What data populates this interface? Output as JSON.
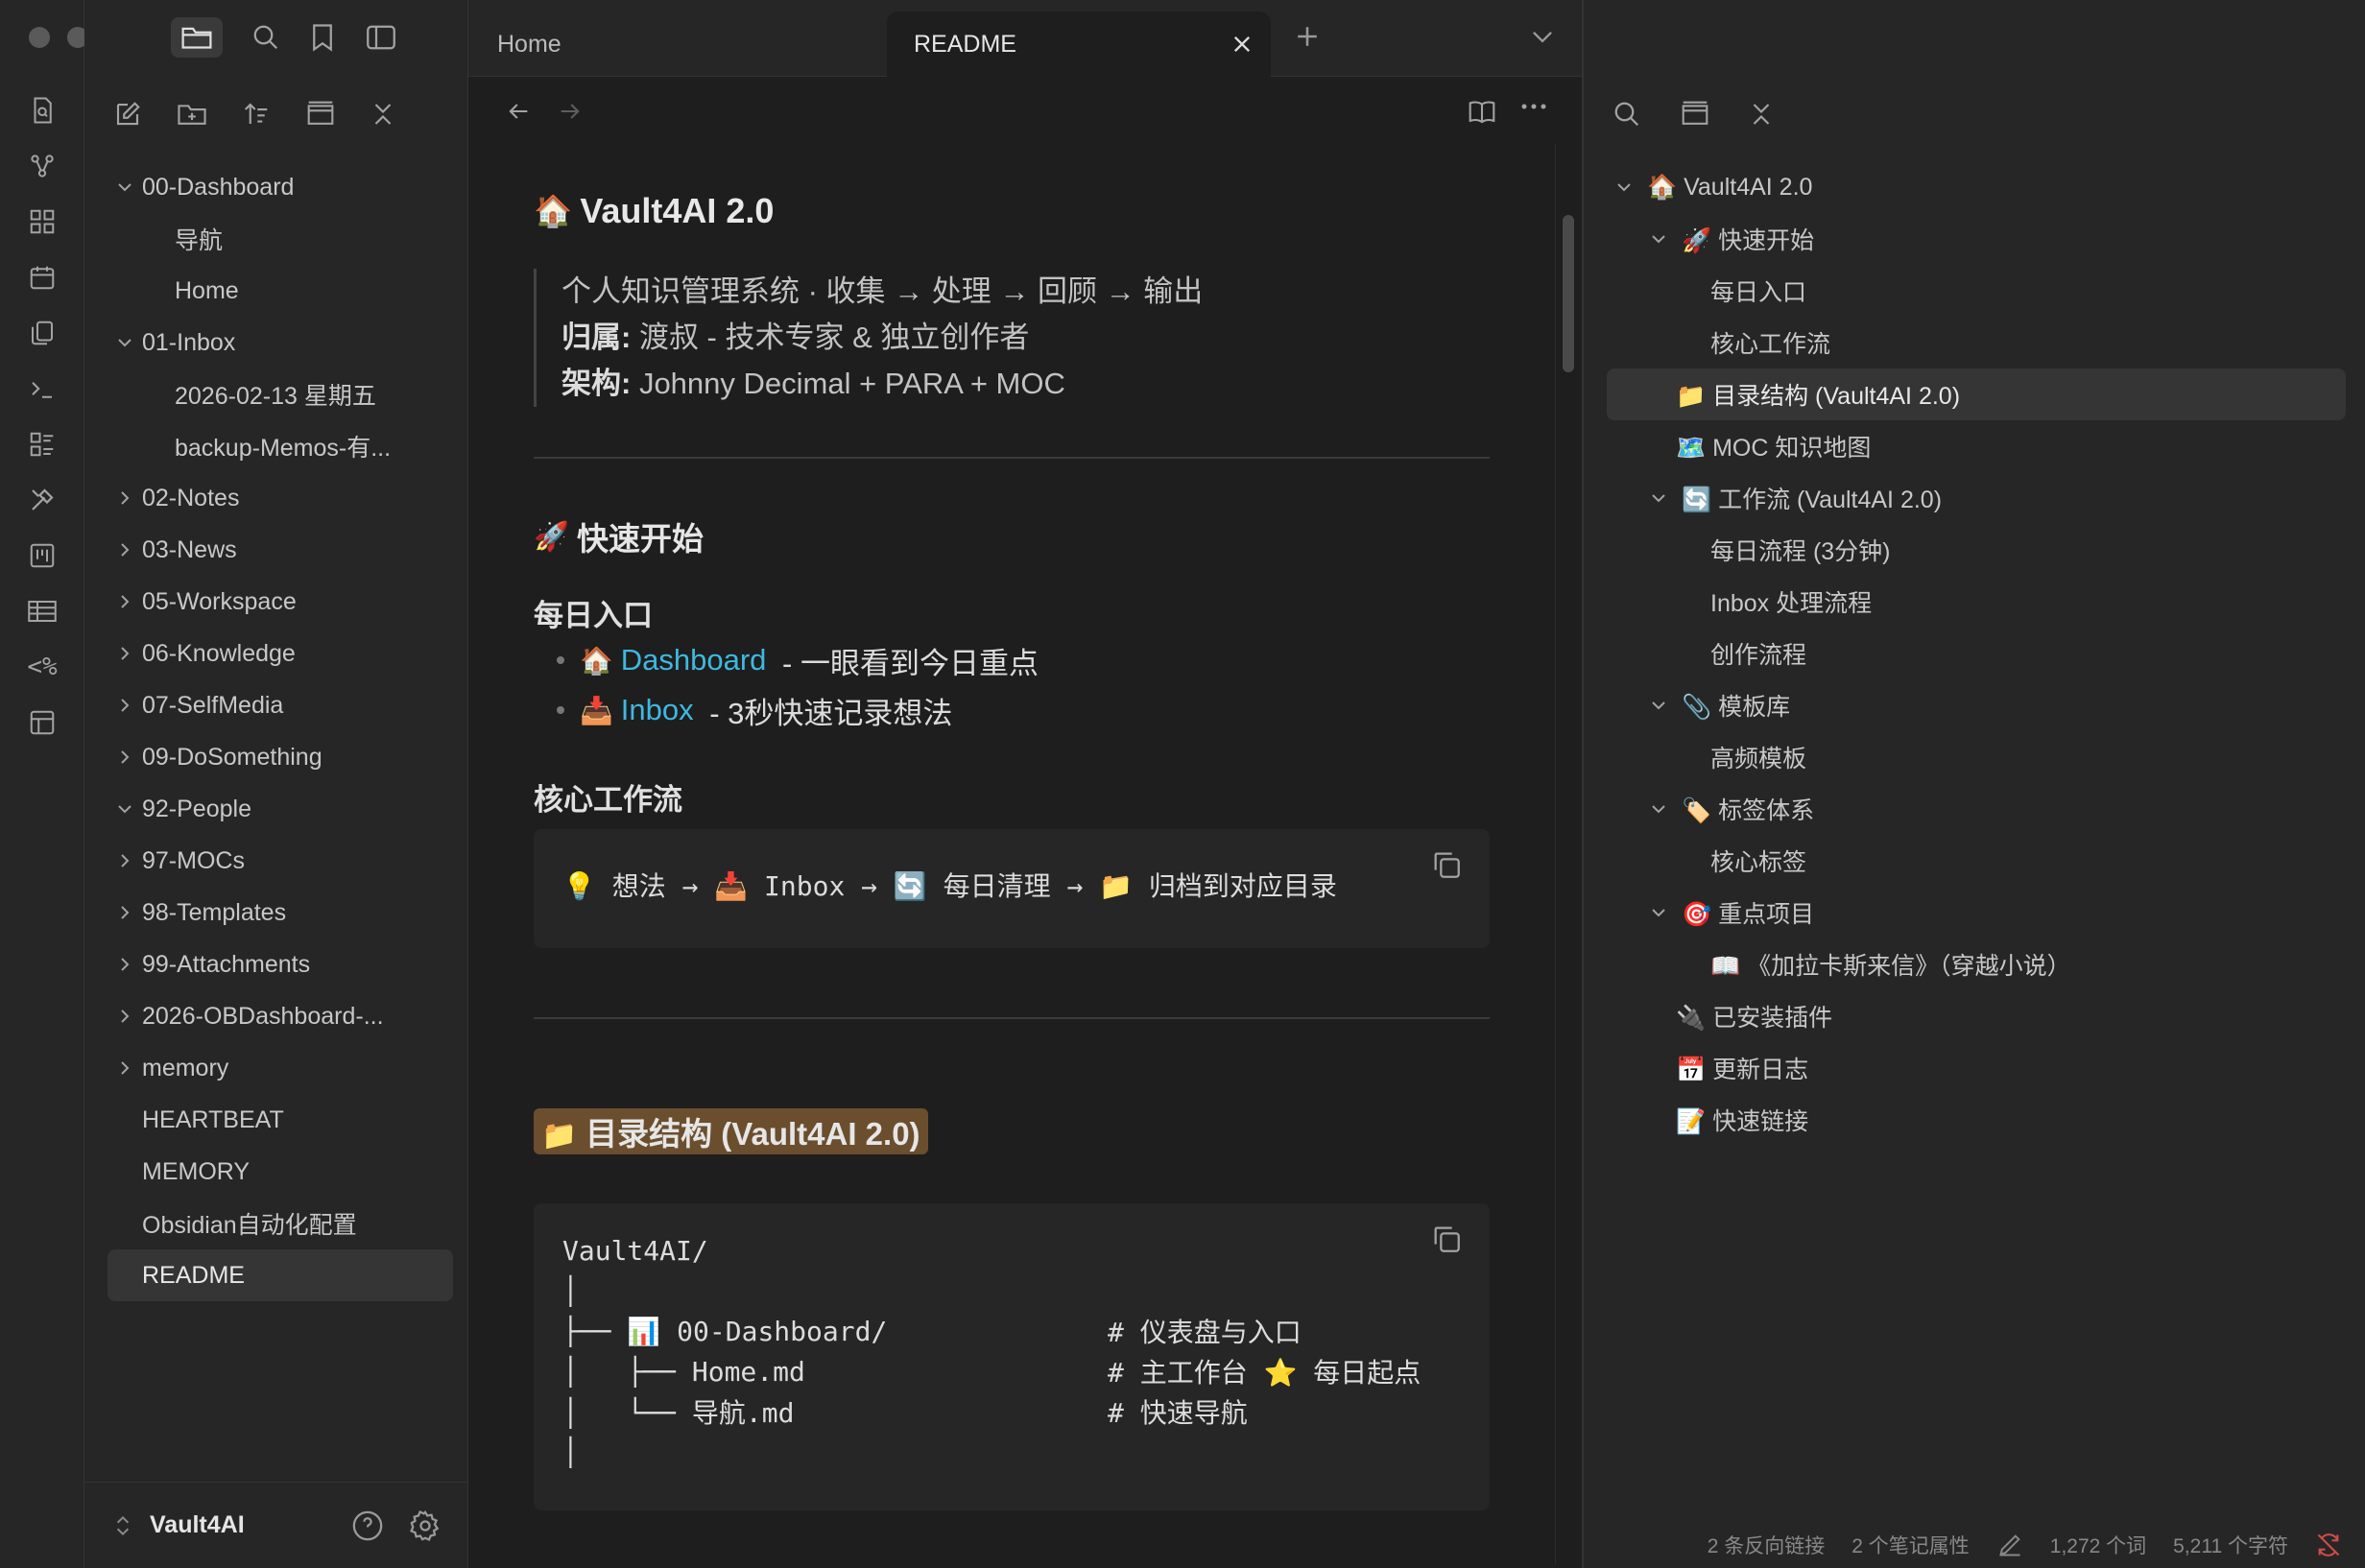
{
  "window": {
    "traffic_lights": [
      "close",
      "minimize",
      "zoom"
    ]
  },
  "tabs": {
    "home": "Home",
    "readme": "README"
  },
  "file_tree": {
    "items": [
      {
        "label": "00-Dashboard",
        "kind": "folder",
        "open": true
      },
      {
        "label": "导航",
        "kind": "sub"
      },
      {
        "label": "Home",
        "kind": "sub"
      },
      {
        "label": "01-Inbox",
        "kind": "folder",
        "open": true
      },
      {
        "label": "2026-02-13 星期五",
        "kind": "sub"
      },
      {
        "label": "backup-Memos-有...",
        "kind": "sub"
      },
      {
        "label": "02-Notes",
        "kind": "folder",
        "open": false
      },
      {
        "label": "03-News",
        "kind": "folder",
        "open": false
      },
      {
        "label": "05-Workspace",
        "kind": "folder",
        "open": false
      },
      {
        "label": "06-Knowledge",
        "kind": "folder",
        "open": false
      },
      {
        "label": "07-SelfMedia",
        "kind": "folder",
        "open": false
      },
      {
        "label": "09-DoSomething",
        "kind": "folder",
        "open": false
      },
      {
        "label": "92-People",
        "kind": "folder",
        "open": true
      },
      {
        "label": "97-MOCs",
        "kind": "folder",
        "open": false
      },
      {
        "label": "98-Templates",
        "kind": "folder",
        "open": false
      },
      {
        "label": "99-Attachments",
        "kind": "folder",
        "open": false
      },
      {
        "label": "2026-OBDashboard-...",
        "kind": "folder",
        "open": false
      },
      {
        "label": "memory",
        "kind": "folder",
        "open": false
      },
      {
        "label": "HEARTBEAT",
        "kind": "file"
      },
      {
        "label": "MEMORY",
        "kind": "file"
      },
      {
        "label": "Obsidian自动化配置",
        "kind": "file"
      },
      {
        "label": "README",
        "kind": "file",
        "active": true
      }
    ],
    "vault_name": "Vault4AI"
  },
  "doc": {
    "title": "Vault4AI 2.0",
    "title_emoji": "🏠",
    "quote_line1": "个人知识管理系统 · 收集 → 处理 → 回顾 → 输出",
    "quote_label2": "归属:",
    "quote_text2": " 渡叔 - 技术专家 & 独立创作者",
    "quote_label3": "架构:",
    "quote_text3": " Johnny Decimal + PARA + MOC",
    "quick_start": "快速开始",
    "quick_start_emoji": "🚀",
    "daily_entry": "每日入口",
    "bullet1_emoji": "🏠",
    "bullet1_link": "Dashboard",
    "bullet1_text": " - 一眼看到今日重点",
    "bullet2_emoji": "📥",
    "bullet2_link": "Inbox",
    "bullet2_text": " - 3秒快速记录想法",
    "core_workflow": "核心工作流",
    "workflow_code": "💡 想法 → 📥 Inbox → 🔄 每日清理 → 📁 归档到对应目录",
    "dir_structure": "目录结构 (Vault4AI 2.0)",
    "dir_emoji": "📁",
    "code_lines": [
      {
        "text": "Vault4AI/",
        "comment": ""
      },
      {
        "text": "│",
        "comment": ""
      },
      {
        "text": "├── 📊 00-Dashboard/",
        "comment": "# 仪表盘与入口"
      },
      {
        "text": "│   ├── Home.md",
        "comment": "# 主工作台 ⭐ 每日起点"
      },
      {
        "text": "│   └── 导航.md",
        "comment": "# 快速导航"
      },
      {
        "text": "│",
        "comment": ""
      }
    ]
  },
  "outline": {
    "items": [
      {
        "label": "🏠 Vault4AI 2.0",
        "level": 0,
        "chev": true
      },
      {
        "label": "🚀 快速开始",
        "level": 1,
        "chev": true
      },
      {
        "label": "每日入口",
        "level": 2,
        "chev": false
      },
      {
        "label": "核心工作流",
        "level": 2,
        "chev": false
      },
      {
        "label": "📁 目录结构 (Vault4AI 2.0)",
        "level": 1,
        "chev": false,
        "active": true
      },
      {
        "label": "🗺️ MOC 知识地图",
        "level": 1,
        "chev": false
      },
      {
        "label": "🔄 工作流 (Vault4AI 2.0)",
        "level": 1,
        "chev": true
      },
      {
        "label": "每日流程 (3分钟)",
        "level": 2,
        "chev": false
      },
      {
        "label": "Inbox 处理流程",
        "level": 2,
        "chev": false
      },
      {
        "label": "创作流程",
        "level": 2,
        "chev": false
      },
      {
        "label": "📎 模板库",
        "level": 1,
        "chev": true
      },
      {
        "label": "高频模板",
        "level": 2,
        "chev": false
      },
      {
        "label": "🏷️ 标签体系",
        "level": 1,
        "chev": true
      },
      {
        "label": "核心标签",
        "level": 2,
        "chev": false
      },
      {
        "label": "🎯 重点项目",
        "level": 1,
        "chev": true
      },
      {
        "label": "📖 《加拉卡斯来信》（穿越小说）",
        "level": 2,
        "chev": false
      },
      {
        "label": "🔌 已安装插件",
        "level": 1,
        "chev": false
      },
      {
        "label": "📅 更新日志",
        "level": 1,
        "chev": false
      },
      {
        "label": "📝 快速链接",
        "level": 1,
        "chev": false
      }
    ]
  },
  "status": {
    "backlinks": "2 条反向链接",
    "properties": "2 个笔记属性",
    "words": "1,272 个词",
    "chars": "5,211 个字符"
  },
  "colors": {
    "link": "#3fb8e0",
    "highlight": "#6b4e2e",
    "active_row": "#353535"
  }
}
